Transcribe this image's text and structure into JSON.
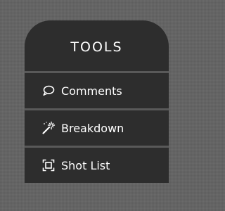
{
  "panel": {
    "title": "TOOLS",
    "items": [
      {
        "label": "Comments",
        "icon": "speech-bubble-icon"
      },
      {
        "label": "Breakdown",
        "icon": "magic-wand-icon"
      },
      {
        "label": "Shot List",
        "icon": "frame-corners-icon"
      }
    ]
  },
  "colors": {
    "panel_background": "#2d2d2d",
    "separator": "#595959",
    "page_background": "#6a6a6a",
    "text": "#ffffff"
  }
}
